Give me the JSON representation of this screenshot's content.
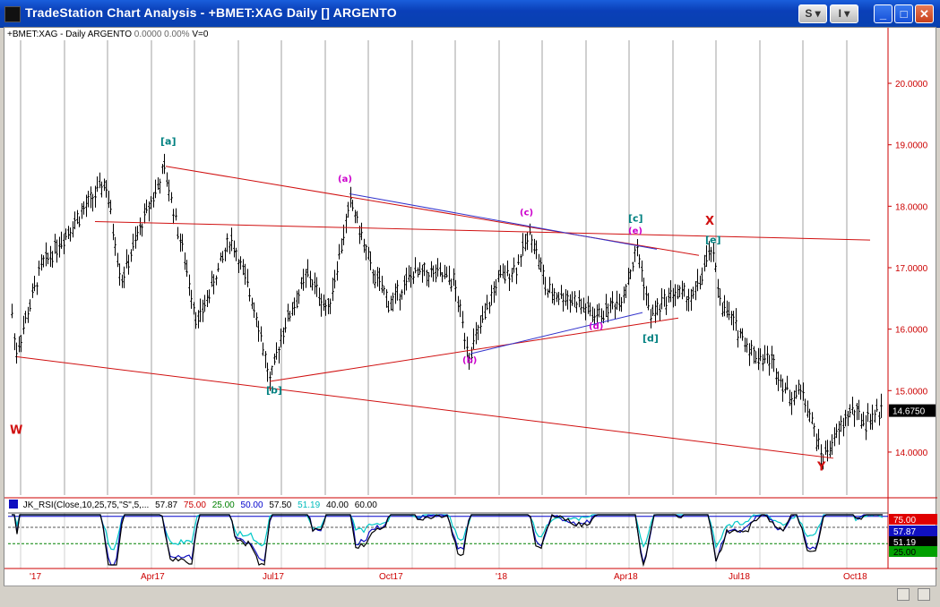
{
  "window": {
    "title": "TradeStation Chart Analysis - +BMET:XAG Daily [] ARGENTO",
    "buttons": {
      "s_label": "S ▾",
      "i_label": "I ▾",
      "minimize": "_",
      "maximize": "□",
      "close": "✕"
    }
  },
  "header": {
    "symbol": "+BMET:XAG - Daily ARGENTO",
    "change": "0.0000",
    "change_pct": "0.00%",
    "volume": "V=0"
  },
  "price_axis": {
    "labels": [
      "20.0000",
      "19.0000",
      "18.0000",
      "17.0000",
      "16.0000",
      "15.0000",
      "14.0000"
    ],
    "last_price": "14.6750",
    "ymin": 13.3,
    "ymax": 20.7
  },
  "time_axis": {
    "labels": [
      "'17",
      "Apr17",
      "Jul17",
      "Oct17",
      "'18",
      "Apr18",
      "Jul18",
      "Oct18"
    ]
  },
  "wave_labels": [
    {
      "text": "W",
      "color": "#d01010"
    },
    {
      "text": "[a]",
      "color": "#008080"
    },
    {
      "text": "[b]",
      "color": "#008080"
    },
    {
      "text": "(a)",
      "color": "#cc00cc"
    },
    {
      "text": "(b)",
      "color": "#cc00cc"
    },
    {
      "text": "(c)",
      "color": "#cc00cc"
    },
    {
      "text": "(d)",
      "color": "#cc00cc"
    },
    {
      "text": "(e)",
      "color": "#cc00cc"
    },
    {
      "text": "[c]",
      "color": "#008080"
    },
    {
      "text": "[d]",
      "color": "#008080"
    },
    {
      "text": "[e]",
      "color": "#008080"
    },
    {
      "text": "X",
      "color": "#d01010"
    },
    {
      "text": "Y",
      "color": "#d01010"
    }
  ],
  "rsi": {
    "name": "JK_RSI",
    "params": "(Close,10,25,75,\"S\",5,...",
    "values": [
      {
        "text": "57.87",
        "color": "#000000"
      },
      {
        "text": "75.00",
        "color": "#cc0000"
      },
      {
        "text": "25.00",
        "color": "#008000"
      },
      {
        "text": "50.00",
        "color": "#0000cc"
      },
      {
        "text": "57.50",
        "color": "#000000"
      },
      {
        "text": "51.19",
        "color": "#00cccc"
      },
      {
        "text": "40.00",
        "color": "#000000"
      },
      {
        "text": "60.00",
        "color": "#000000"
      }
    ],
    "axis_labels": [
      {
        "text": "75.00",
        "bg": "#e00000",
        "fg": "#ffffff"
      },
      {
        "text": "57.87",
        "bg": "#1010c0",
        "fg": "#ffffff"
      },
      {
        "text": "51.19",
        "bg": "#000000",
        "fg": "#ffffff"
      },
      {
        "text": "25.00",
        "bg": "#00a000",
        "fg": "#000000"
      }
    ]
  },
  "colors": {
    "price_bars": "#000000",
    "trendlines": "#d01010",
    "wedge_lines": "#3333cc",
    "grid": "#a0a0a0"
  }
}
